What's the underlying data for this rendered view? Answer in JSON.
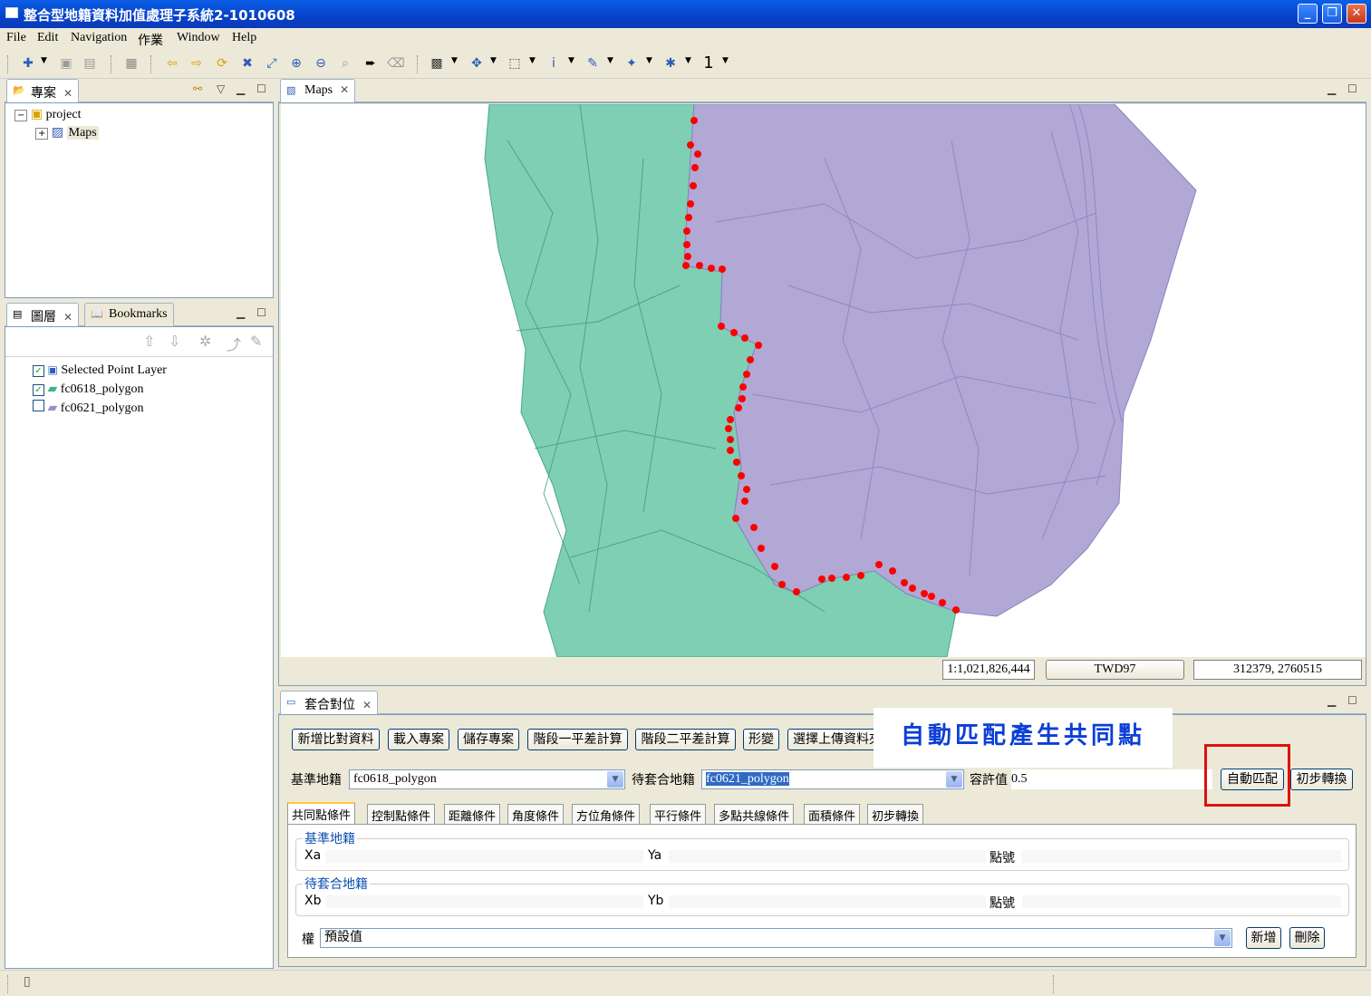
{
  "window": {
    "title": "整合型地籍資料加值處理子系統2-1010608",
    "buttons": [
      "_",
      "❐",
      "✕"
    ]
  },
  "menu": [
    "File",
    "Edit",
    "Navigation",
    "作業",
    "Window",
    "Help"
  ],
  "toolbar": {
    "scale_label": "1"
  },
  "project_panel": {
    "tab_label": "專案",
    "tree": {
      "root": "project",
      "child": "Maps"
    }
  },
  "layers_panel": {
    "tab_label": "圖層",
    "bookmarks_label": "Bookmarks",
    "layers": [
      {
        "name": "Selected Point Layer",
        "checked": true
      },
      {
        "name": "fc0618_polygon",
        "checked": true
      },
      {
        "name": "fc0621_polygon",
        "checked": false
      }
    ]
  },
  "map_panel": {
    "tab_label": "Maps",
    "status": {
      "scale": "1:1,021,826,444",
      "crs": "TWD97",
      "coords": "312379, 2760515"
    },
    "colors": {
      "green_polygon": "#7ecfb3",
      "purple_polygon": "#b1a8d6",
      "match_points": "#ff0000"
    }
  },
  "match_panel": {
    "tab_label": "套合對位",
    "buttons": [
      "新增比對資料",
      "載入專案",
      "儲存專案",
      "階段一平差計算",
      "階段二平差計算",
      "形變",
      "選擇上傳資料夾"
    ],
    "annotation": "自動匹配產生共同點",
    "base_label": "基準地籍",
    "base_value": "fc0618_polygon",
    "target_label": "待套合地籍",
    "target_value": "fc0621_polygon",
    "tolerance_label": "容許值",
    "tolerance_value": "0.5",
    "auto_match_button": "自動匹配",
    "initial_transform_button": "初步轉換",
    "tabs": [
      "共同點條件",
      "控制點條件",
      "距離條件",
      "角度條件",
      "方位角條件",
      "平行條件",
      "多點共線條件",
      "面積條件",
      "初步轉換"
    ],
    "group_base": {
      "title": "基準地籍",
      "x": "Xa",
      "y": "Ya",
      "pt": "點號"
    },
    "group_target": {
      "title": "待套合地籍",
      "x": "Xb",
      "y": "Yb",
      "pt": "點號"
    },
    "weight_label": "權",
    "weight_value": "預設值",
    "add_button": "新增",
    "delete_button": "刪除"
  }
}
